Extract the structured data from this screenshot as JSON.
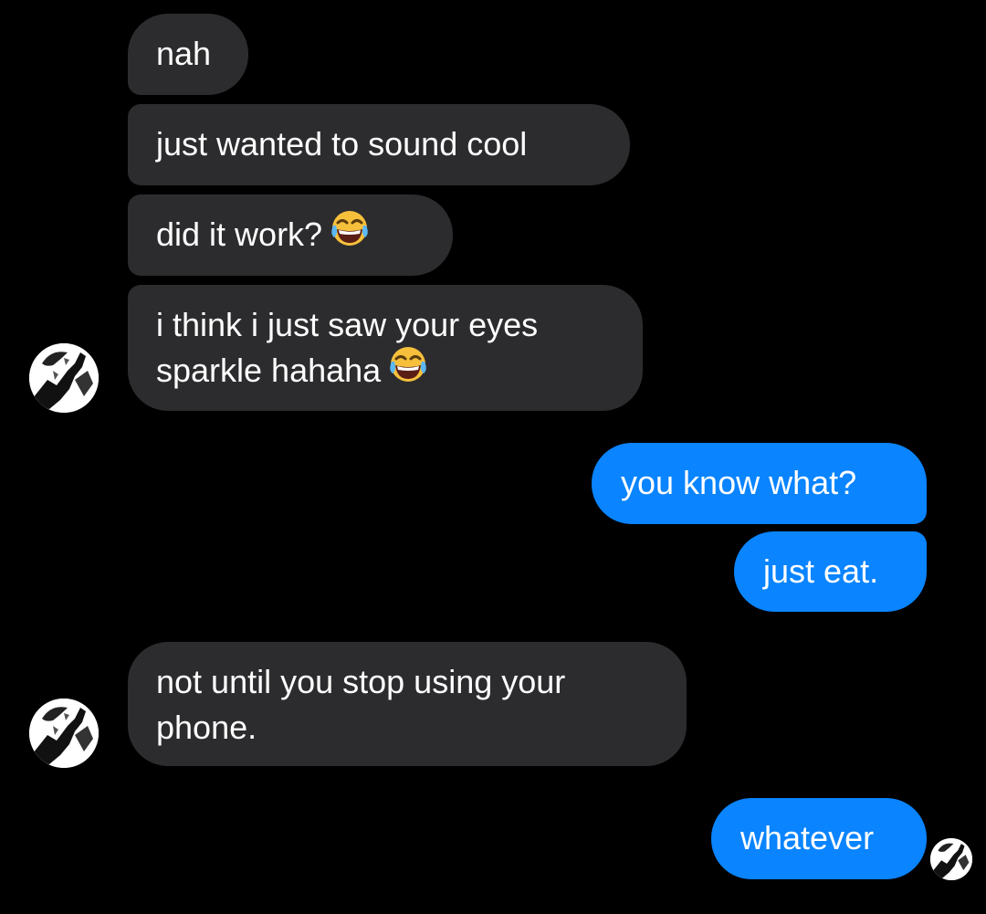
{
  "conversation": {
    "messages": [
      {
        "id": "m1",
        "sender": "them",
        "text": "nah"
      },
      {
        "id": "m2",
        "sender": "them",
        "text": "just wanted to sound cool"
      },
      {
        "id": "m3",
        "sender": "them",
        "text": "did it work?",
        "emoji": "face-with-tears-of-joy"
      },
      {
        "id": "m4",
        "sender": "them",
        "line1": "i think i just saw your eyes",
        "line2": "sparkle hahaha",
        "emoji": "face-with-tears-of-joy"
      },
      {
        "id": "m5",
        "sender": "me",
        "text": "you know what?"
      },
      {
        "id": "m6",
        "sender": "me",
        "text": "just eat."
      },
      {
        "id": "m7",
        "sender": "them",
        "line1": "not until you stop using your",
        "line2": "phone."
      },
      {
        "id": "m8",
        "sender": "me",
        "text": "whatever",
        "read_receipt": "avatar"
      }
    ]
  },
  "colors": {
    "background": "#000000",
    "incoming_bubble": "#2c2c2e",
    "outgoing_bubble": "#0a84ff",
    "text": "#ffffff"
  },
  "icons": {
    "contact_avatar": "contact-avatar-icon",
    "seen_avatar": "seen-avatar-icon",
    "emoji": "face-with-tears-of-joy"
  }
}
